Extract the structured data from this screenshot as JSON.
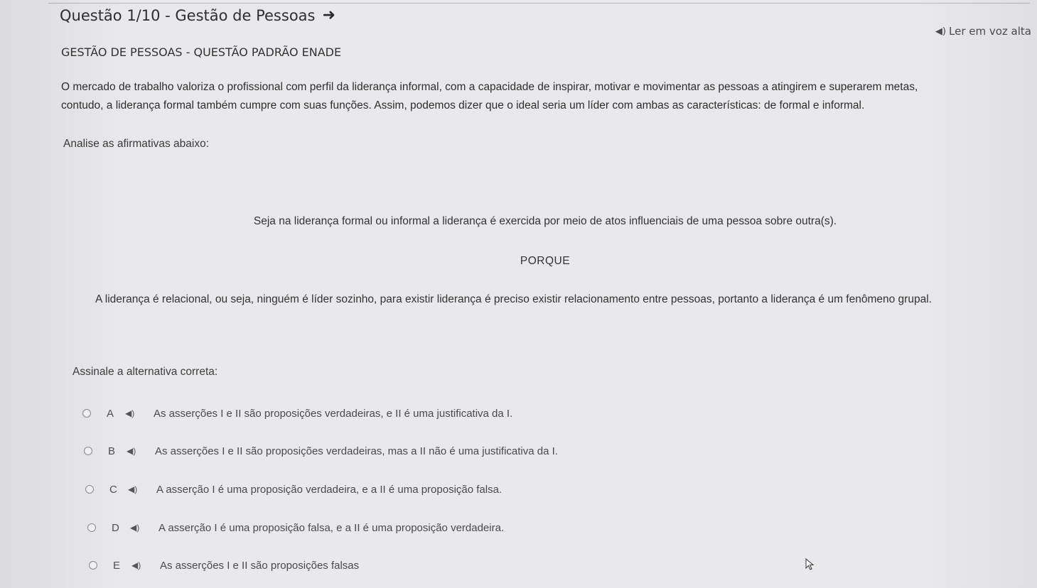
{
  "header": {
    "title": "Questão 1/10 - Gestão de Pessoas",
    "read_aloud_label": "Ler em voz alta"
  },
  "question": {
    "subtitle": "GESTÃO DE PESSOAS - QUESTÃO PADRÃO ENADE",
    "paragraph_line1": "O mercado de trabalho valoriza o profissional com perfil da liderança informal, com a capacidade de inspirar, motivar e movimentar as pessoas a atingirem e superarem metas,",
    "paragraph_line2": "contudo, a liderança formal também cumpre com suas funções. Assim, podemos dizer que o ideal seria um líder com ambas as características: de formal e informal.",
    "instruction": "Analise as afirmativas abaixo:",
    "assertion_1": "Seja na liderança formal ou informal a liderança é exercida por meio de atos influenciais de uma pessoa sobre outra(s).",
    "connector": "PORQUE",
    "assertion_2": "A liderança é relacional, ou seja, ninguém é líder sozinho, para existir liderança é preciso existir relacionamento entre pessoas, portanto a liderança é um fenômeno grupal.",
    "prompt": "Assinale a alternativa correta:"
  },
  "options": [
    {
      "letter": "A",
      "text": "As asserções I e II são proposições verdadeiras, e II  é uma justificativa da I."
    },
    {
      "letter": "B",
      "text": "As asserções I e II são proposições verdadeiras, mas a II não é uma justificativa da I."
    },
    {
      "letter": "C",
      "text": "A asserção I é uma proposição verdadeira, e a II é uma proposição falsa."
    },
    {
      "letter": "D",
      "text": "A asserção I é uma proposição falsa, e a II é uma proposição verdadeira."
    },
    {
      "letter": "E",
      "text": "As asserções I e II são proposições falsas"
    }
  ],
  "icons": {
    "title_arrow": "arrow-right-icon",
    "read_aloud": "speaker-icon",
    "option_audio": "speaker-icon",
    "pointer": "mouse-cursor-icon"
  }
}
